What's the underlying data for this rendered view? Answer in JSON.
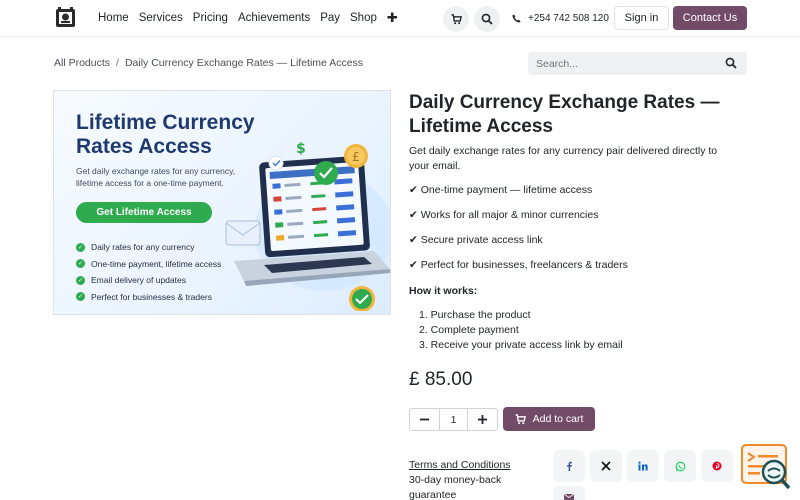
{
  "nav": {
    "items": [
      "Home",
      "Services",
      "Pricing",
      "Achievements",
      "Pay",
      "Shop"
    ],
    "phone": "+254 742 508 120",
    "signin": "Sign in",
    "contact": "Contact Us"
  },
  "breadcrumb": {
    "parent": "All Products",
    "sep": "/",
    "current": "Daily Currency Exchange Rates — Lifetime Access"
  },
  "search": {
    "placeholder": "Search..."
  },
  "image": {
    "title": "Lifetime Currency Rates Access",
    "subtitle": "Get daily exchange rates for any currency, lifetime access for a one-time payment.",
    "button": "Get Lifetime Access",
    "list": [
      "Daily rates for any currency",
      "One-time payment, lifetime access",
      "Email delivery of updates",
      "Perfect for businesses & traders"
    ]
  },
  "product": {
    "title": "Daily Currency Exchange Rates — Lifetime Access",
    "description": "Get daily exchange rates for any currency pair delivered directly to your email.",
    "features": [
      "✔ One-time payment — lifetime access",
      "✔ Works for all major & minor currencies",
      "✔ Secure private access link",
      "✔ Perfect for businesses, freelancers & traders"
    ],
    "how_title": "How it works:",
    "steps": [
      "1. Purchase the product",
      "2. Complete payment",
      "3. Receive your private access link by email"
    ],
    "price": "£ 85.00",
    "quantity": "1",
    "add_to_cart": "Add to cart",
    "terms": "Terms and Conditions",
    "guarantee": "30-day money-back guarantee"
  },
  "share": [
    "facebook-icon",
    "x-icon",
    "linkedin-icon",
    "whatsapp-icon",
    "pinterest-icon",
    "email-icon"
  ],
  "colors": {
    "brand": "#714b67",
    "green": "#2eaa4f",
    "navy": "#1e3a6e"
  }
}
